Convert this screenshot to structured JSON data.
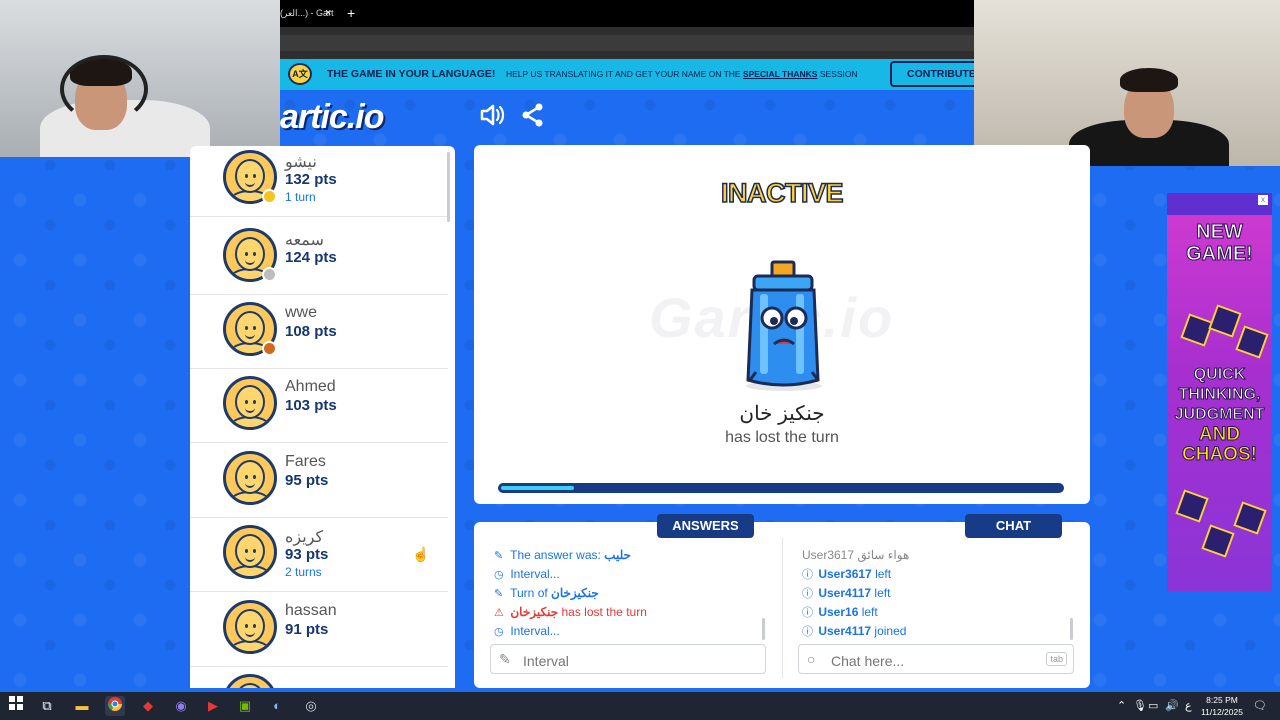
{
  "browser": {
    "tab_title": "(العر...) - Gart",
    "tab_close": "×",
    "new_tab": "+"
  },
  "banner": {
    "badge": "A文",
    "headline": "THE GAME IN YOUR LANGUAGE!",
    "message_prefix": "HELP US TRANSLATING IT AND GET YOUR NAME ON THE",
    "message_link": "SPECIAL THANKS",
    "message_suffix": "SESSION",
    "contribute_label": "CONTRIBUTE"
  },
  "header": {
    "brand": "artic.io",
    "sound_icon": "speaker-icon",
    "share_icon": "share-icon"
  },
  "players": [
    {
      "name": "نيشو",
      "points": "132 pts",
      "turns": "1 turn",
      "medal_color": "#f6c324"
    },
    {
      "name": "سمعه",
      "points": "124 pts",
      "turns": "",
      "medal_color": "#bdbdbd"
    },
    {
      "name": "wwe",
      "points": "108 pts",
      "turns": "",
      "medal_color": "#d2691e"
    },
    {
      "name": "Ahmed",
      "points": "103 pts",
      "turns": ""
    },
    {
      "name": "Fares",
      "points": "95 pts",
      "turns": ""
    },
    {
      "name": "كريزه",
      "points": "93 pts",
      "turns": "2 turns"
    },
    {
      "name": "hassan",
      "points": "91 pts",
      "turns": ""
    }
  ],
  "stage": {
    "status": "INACTIVE",
    "watermark": "Gartic.io",
    "player_word": "جنكيز خان",
    "message": "has lost the turn",
    "timer_fraction": 0.13
  },
  "answers": {
    "tab_label": "ANSWERS",
    "entries": [
      {
        "icon": "pencil-icon",
        "text": "The answer was:",
        "highlight": "حليب"
      },
      {
        "icon": "clock-icon",
        "text": "Interval...",
        "highlight": ""
      },
      {
        "icon": "pencil-icon",
        "text": "Turn of",
        "highlight": "جنكيزخان"
      },
      {
        "icon": "warning-icon",
        "text": "has lost the turn",
        "highlight": "جنكيزخان"
      },
      {
        "icon": "clock-icon",
        "text": "Interval...",
        "highlight": ""
      }
    ],
    "input_placeholder": "Interval"
  },
  "chat": {
    "tab_label": "CHAT",
    "first_message": {
      "user": "User3617",
      "text": "هواء سائق"
    },
    "entries": [
      {
        "user": "User3617",
        "action": "left"
      },
      {
        "user": "User4117",
        "action": "left"
      },
      {
        "user": "User16",
        "action": "left"
      },
      {
        "user": "User4117",
        "action": "joined"
      }
    ],
    "input_placeholder": "Chat here...",
    "tab_key": "tab"
  },
  "ad": {
    "headline": "NEW GAME!",
    "line1": "QUICK",
    "line2": "THINKING,",
    "line3": "JUDGMENT",
    "line4": "AND",
    "line5": "CHAOS!",
    "close": "x"
  },
  "taskbar": {
    "time": "8:25 PM",
    "date": "11/12/2025",
    "lang": "ع"
  },
  "colors": {
    "background": "#1e6cf2",
    "navy": "#173b84",
    "banner": "#18b8e6",
    "accent_yellow": "#ffd43b"
  }
}
